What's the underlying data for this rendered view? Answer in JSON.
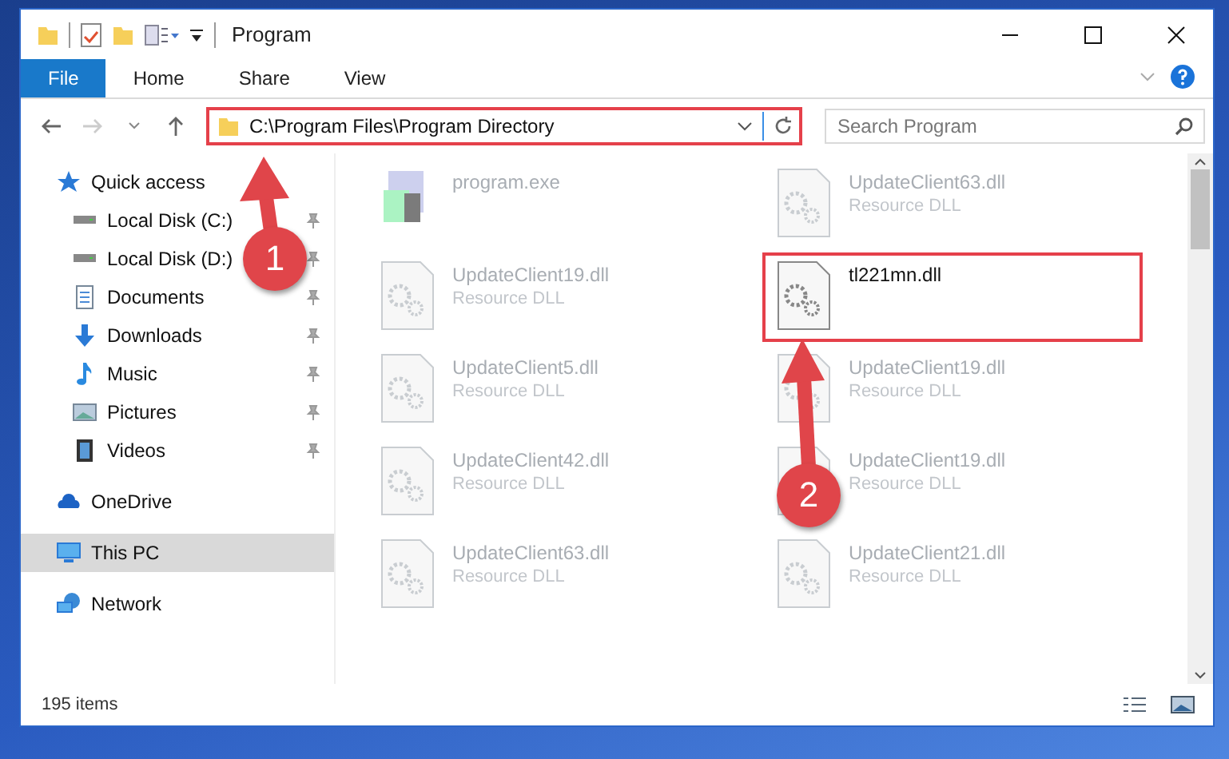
{
  "window": {
    "title": "Program"
  },
  "ribbon_tabs": [
    {
      "label": "File",
      "selected": true
    },
    {
      "label": "Home",
      "selected": false
    },
    {
      "label": "Share",
      "selected": false
    },
    {
      "label": "View",
      "selected": false
    }
  ],
  "address_bar": {
    "path": "C:\\Program Files\\Program Directory",
    "highlighted": true
  },
  "search": {
    "placeholder": "Search Program"
  },
  "sidebar": {
    "items": [
      {
        "label": "Quick access",
        "kind": "star",
        "selected": false,
        "children": [
          {
            "label": "Local Disk (C:)",
            "kind": "drive",
            "pinned": true,
            "selected": false
          },
          {
            "label": "Local Disk (D:)",
            "kind": "drive",
            "pinned": true,
            "selected": false
          },
          {
            "label": "Documents",
            "kind": "documents",
            "pinned": true,
            "selected": false
          },
          {
            "label": "Downloads",
            "kind": "downloads",
            "pinned": true,
            "selected": false
          },
          {
            "label": "Music",
            "kind": "music",
            "pinned": true,
            "selected": false
          },
          {
            "label": "Pictures",
            "kind": "pictures",
            "pinned": true,
            "selected": false
          },
          {
            "label": "Videos",
            "kind": "videos",
            "pinned": true,
            "selected": false
          }
        ]
      },
      {
        "label": "OneDrive",
        "kind": "cloud",
        "selected": false
      },
      {
        "label": "This PC",
        "kind": "pc",
        "selected": true
      },
      {
        "label": "Network",
        "kind": "network",
        "selected": false
      }
    ]
  },
  "files": [
    {
      "name": "program.exe",
      "kind": "exe",
      "highlighted": false
    },
    {
      "name": "UpdateClient63.dll",
      "type": "Resource DLL",
      "kind": "dll",
      "highlighted": false
    },
    {
      "name": "UpdateClient19.dll",
      "type": "Resource DLL",
      "kind": "dll",
      "highlighted": false
    },
    {
      "name": "tl221mn.dll",
      "kind": "dll",
      "highlighted": true
    },
    {
      "name": "UpdateClient5.dll",
      "type": "Resource DLL",
      "kind": "dll",
      "highlighted": false
    },
    {
      "name": "UpdateClient19.dll",
      "type": "Resource DLL",
      "kind": "dll",
      "highlighted": false
    },
    {
      "name": "UpdateClient42.dll",
      "type": "Resource DLL",
      "kind": "dll",
      "highlighted": false
    },
    {
      "name": "UpdateClient19.dll",
      "type": "Resource DLL",
      "kind": "dll",
      "highlighted": false
    },
    {
      "name": "UpdateClient63.dll",
      "type": "Resource DLL",
      "kind": "dll",
      "highlighted": false
    },
    {
      "name": "UpdateClient21.dll",
      "type": "Resource DLL",
      "kind": "dll",
      "highlighted": false
    }
  ],
  "status_bar": {
    "item_count": "195 items"
  },
  "annotations": [
    {
      "label": "1"
    },
    {
      "label": "2"
    }
  ]
}
